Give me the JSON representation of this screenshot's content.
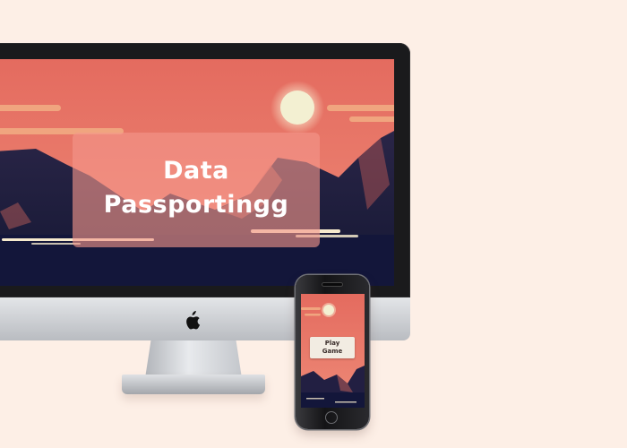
{
  "desktop": {
    "title_line1": "Data",
    "title_line2": "Passportingg"
  },
  "mobile": {
    "button_line1": "Play",
    "button_line2": "Game"
  },
  "colors": {
    "page_background": "#fdefe6",
    "sky": "#e7766a",
    "sun": "#f3f0d2",
    "mountains": "#1b1b3a",
    "overlay": "#f4968a"
  }
}
